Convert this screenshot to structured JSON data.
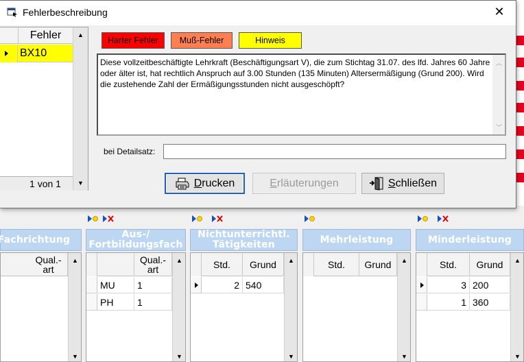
{
  "dialog": {
    "title": "Fehlerbeschreibung",
    "close_glyph": "✕",
    "error_list": {
      "header": "Fehler",
      "rows": [
        {
          "code": "BX10"
        }
      ],
      "nav_text": "1 von 1"
    },
    "legend": {
      "hard": {
        "label": "Harter Fehler",
        "color": "#ff0000"
      },
      "must": {
        "label": "Muß-Fehler",
        "color": "#ff7f50"
      },
      "hint": {
        "label": "Hinweis",
        "color": "#ffff00"
      }
    },
    "message": "Diese vollzeitbeschäftigte Lehrkraft (Beschäftigungsart V), die zum Stichtag 31.07. des lfd. Jahres 60 Jahre oder älter ist, hat rechtlich Anspruch auf 3.00 Stunden (135 Minuten) Altersermäßigung (Grund 200). Wird die zustehende Zahl der Ermäßigungsstunden nicht ausgeschöpft?",
    "detail_label": "bei Detailsatz:",
    "detail_value": "",
    "buttons": {
      "print": {
        "first": "D",
        "rest": "rucken",
        "icon": "printer-icon"
      },
      "explain": {
        "first": "E",
        "rest": "rläuterungen"
      },
      "close": {
        "first": "S",
        "rest": "chließen",
        "icon": "exit-door-icon"
      }
    }
  },
  "panels": {
    "fachrichtung": {
      "header": "Fachrichtung",
      "col_qual": "Qual.-\nart"
    },
    "ausfortbildung": {
      "header": "Aus-/\nFortbildungsfach",
      "col_qual": "Qual.-\nart",
      "rows": [
        {
          "fach": "MU",
          "qual": "1"
        },
        {
          "fach": "PH",
          "qual": "1"
        }
      ]
    },
    "nichtunterricht": {
      "header": "Nichtunterrichtl.\nTätigkeiten",
      "col_std": "Std.",
      "col_grund": "Grund",
      "rows": [
        {
          "std": "2",
          "grund": "540"
        }
      ]
    },
    "mehrleistung": {
      "header": "Mehrleistung",
      "col_std": "Std.",
      "col_grund": "Grund"
    },
    "minderleistung": {
      "header": "Minderleistung",
      "col_std": "Std.",
      "col_grund": "Grund",
      "rows": [
        {
          "std": "3",
          "grund": "200"
        },
        {
          "std": "1",
          "grund": "360"
        }
      ]
    }
  },
  "colors": {
    "panel_header": "#bdd7f2",
    "selected_row": "#ffff00",
    "accent_stripes": "#e8001c"
  }
}
